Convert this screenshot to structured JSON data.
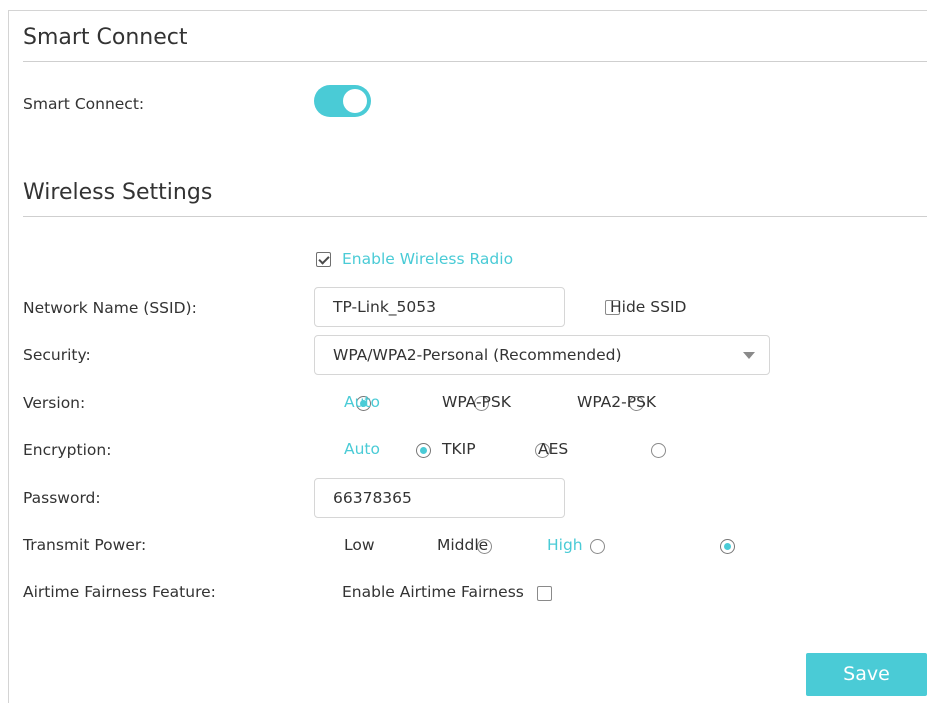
{
  "smart_connect": {
    "section_title": "Smart Connect",
    "label": "Smart Connect:",
    "enabled": true
  },
  "wireless": {
    "section_title": "Wireless Settings",
    "enable_radio_label": "Enable Wireless Radio",
    "enable_radio_checked": true,
    "ssid": {
      "label": "Network Name (SSID):",
      "value": "TP-Link_5053",
      "hide_label": "Hide SSID",
      "hide_checked": false
    },
    "security": {
      "label": "Security:",
      "value": "WPA/WPA2-Personal (Recommended)"
    },
    "version": {
      "label": "Version:",
      "options": [
        "Auto",
        "WPA-PSK",
        "WPA2-PSK"
      ],
      "selected": "Auto"
    },
    "encryption": {
      "label": "Encryption:",
      "options": [
        "Auto",
        "TKIP",
        "AES"
      ],
      "selected": "Auto"
    },
    "password": {
      "label": "Password:",
      "value": "66378365"
    },
    "transmit_power": {
      "label": "Transmit Power:",
      "options": [
        "Low",
        "Middle",
        "High"
      ],
      "selected": "High"
    },
    "airtime": {
      "label": "Airtime Fairness Feature:",
      "checkbox_label": "Enable Airtime Fairness",
      "checked": false
    }
  },
  "save_label": "Save",
  "colors": {
    "accent": "#4acbd6",
    "text": "#333333",
    "divider": "#cfcfcf"
  }
}
